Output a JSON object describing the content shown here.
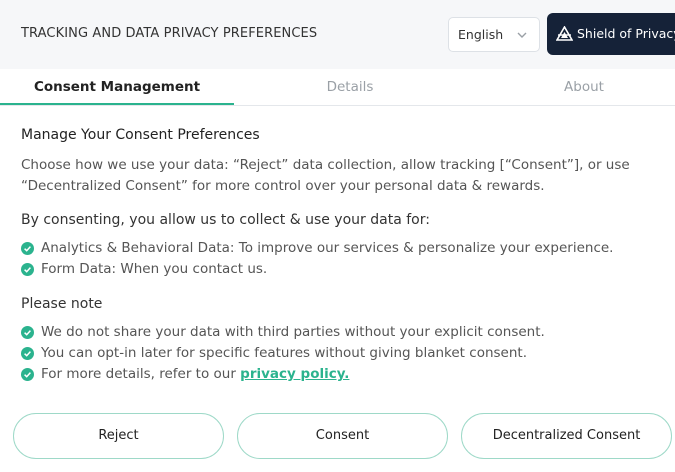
{
  "header": {
    "title": "TRACKING AND DATA PRIVACY PREFERENCES",
    "language": "English",
    "brand_label": "Shield of Privacy",
    "icons": {
      "chevron": "chevron-down-icon",
      "brand": "shield-logo-icon"
    }
  },
  "tabs": [
    {
      "label": "Consent Management",
      "active": true
    },
    {
      "label": "Details",
      "active": false
    },
    {
      "label": "About",
      "active": false
    }
  ],
  "content": {
    "heading": "Manage Your Consent Preferences",
    "description": "Choose how we use your data: “Reject” data collection, allow tracking [“Consent”], or use “Decentralized Consent” for more control over your personal data & rewards.",
    "by_consenting": "By consenting, you allow us to collect & use your data for:",
    "uses": [
      "Analytics & Behavioral Data: To improve our services & personalize your experience.",
      "Form Data: When you contact us."
    ],
    "note_heading": "Please note",
    "notes": [
      "We do not share your data with third parties without your explicit consent.",
      "You can opt-in later for specific features without giving blanket consent."
    ],
    "policy_prefix": "For more details, refer to our",
    "policy_link": "privacy policy."
  },
  "buttons": {
    "reject": "Reject",
    "consent": "Consent",
    "decentralized": "Decentralized Consent"
  },
  "colors": {
    "accent": "#2bb38e",
    "brand_bg": "#152238",
    "header_bg": "#f6f7f9",
    "button_border": "#9ed9c8"
  }
}
